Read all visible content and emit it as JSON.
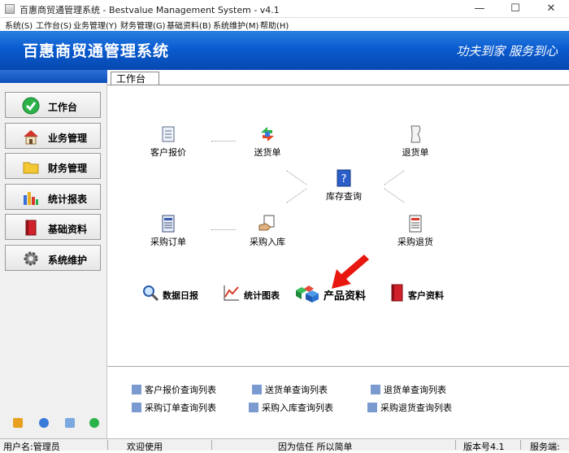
{
  "window": {
    "title": "百惠商贸通管理系统 - Bestvalue Management System - v4.1",
    "controls": [
      "—",
      "☐",
      "✕"
    ]
  },
  "menu": [
    "系统(S)",
    "工作台(S)",
    "业务管理(Y)",
    "财务管理(G)",
    "基础资料(B)",
    "系统维护(M)",
    "帮助(H)"
  ],
  "banner": {
    "app_name": "百惠商贸通管理系统",
    "slogan": "功夫到家  服务到心"
  },
  "sidebar": {
    "items": [
      {
        "label": "工作台",
        "icon": "checkmark-icon"
      },
      {
        "label": "业务管理",
        "icon": "house-icon"
      },
      {
        "label": "财务管理",
        "icon": "folder-icon"
      },
      {
        "label": "统计报表",
        "icon": "bar-chart-icon"
      },
      {
        "label": "基础资料",
        "icon": "red-book-icon"
      },
      {
        "label": "系统维护",
        "icon": "gear-icon"
      }
    ]
  },
  "tab": {
    "label": "工作台"
  },
  "flow": {
    "customer_quote": "客户报价",
    "delivery_note": "送货单",
    "return_note": "退货单",
    "inventory_query": "库存查询",
    "purchase_order": "采购订单",
    "purchase_inbound": "采购入库",
    "purchase_return": "采购退货"
  },
  "tools": {
    "daily_report": "数据日报",
    "stats_chart": "统计图表",
    "product_info": "产品资料",
    "customer_info": "客户资料"
  },
  "query_links": [
    "客户报价查询列表",
    "送货单查询列表",
    "退货单查询列表",
    "采购订单查询列表",
    "采购入库查询列表",
    "采购退货查询列表"
  ],
  "statusbar": {
    "user": "用户名:管理员",
    "welcome": "欢迎使用",
    "motto": "因为信任 所以简单",
    "version": "版本号4.1",
    "service": "服务端:"
  },
  "colors": {
    "banner_blue": "#0a5cd0",
    "arrow_red": "#e8170f"
  }
}
